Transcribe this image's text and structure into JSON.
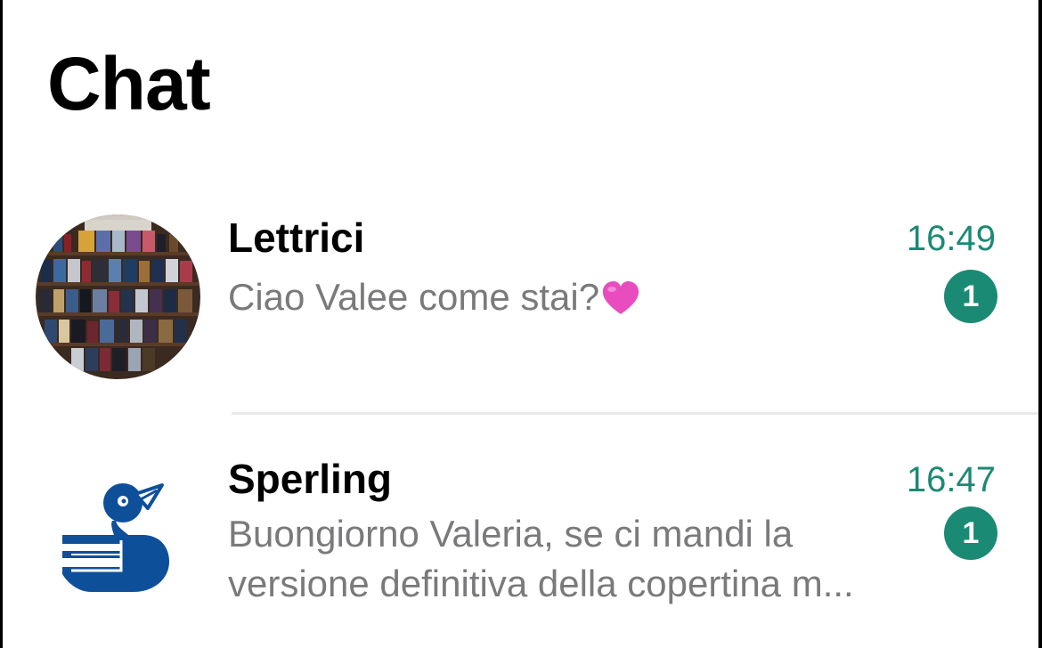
{
  "header": {
    "title": "Chat"
  },
  "chats": [
    {
      "name": "Lettrici",
      "time": "16:49",
      "preview": "Ciao Valee come stai?",
      "preview_emoji": "pink-heart",
      "unread": "1",
      "avatar": "bookshelf-photo"
    },
    {
      "name": "Sperling",
      "time": "16:47",
      "preview": "Buongiorno Valeria, se ci mandi la versione definitiva della copertina m...",
      "unread": "1",
      "avatar": "bird-on-books-logo"
    }
  ],
  "colors": {
    "accent": "#1b8a74",
    "preview_text": "#7a7a7c",
    "divider": "#e8e8ea",
    "logo_blue": "#0e4f9a"
  }
}
